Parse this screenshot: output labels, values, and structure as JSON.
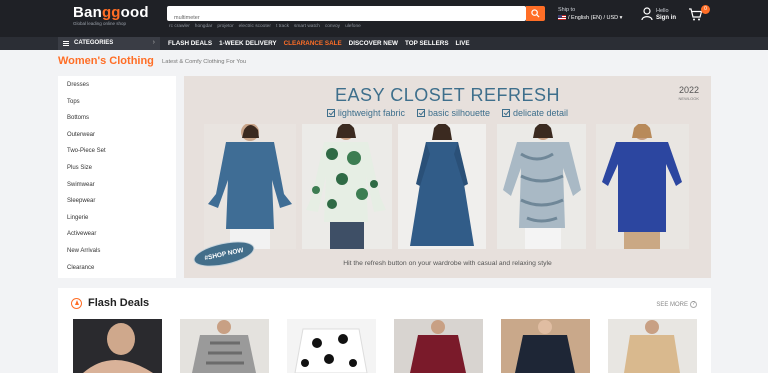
{
  "header": {
    "logo_text": "Banggood",
    "logo_tagline": "Global leading online shop",
    "search": {
      "value": "multimeter",
      "placeholder": ""
    },
    "hot_terms": [
      "rc crawler",
      "hongdar",
      "projetor",
      "electric scooter",
      "t track",
      "smart watch",
      "convoy",
      "ulefone"
    ],
    "ship_to_label": "Ship to",
    "ship_to_value": "/ English (EN) / USD",
    "hello_label": "Hello",
    "signin_label": "Sign in",
    "cart_count": "0"
  },
  "nav": {
    "categories_label": "CATEGORIES",
    "links": [
      "FLASH DEALS",
      "1-WEEK DELIVERY",
      "CLEARANCE SALE",
      "DISCOVER NEW",
      "TOP SELLERS",
      "LIVE"
    ]
  },
  "page": {
    "title": "Women's Clothing",
    "subtitle": "Latest & Comfy Clothing For You"
  },
  "sidebar": {
    "items": [
      "Dresses",
      "Tops",
      "Bottoms",
      "Outerwear",
      "Two-Piece Set",
      "Plus Size",
      "Swimwear",
      "Sleepwear",
      "Lingerie",
      "Activewear",
      "New Arrivals",
      "Clearance"
    ]
  },
  "banner": {
    "title": "EASY CLOSET REFRESH",
    "year": "2022",
    "year_sub": "NEWLOOK",
    "features": [
      "lightweight fabric",
      "basic silhouette",
      "delicate detail"
    ],
    "shop_now": "#SHOP NOW",
    "footer": "Hit the refresh button on your wardrobe with casual and relaxing style"
  },
  "flash_deals": {
    "title": "Flash Deals",
    "see_more": "SEE MORE"
  },
  "colors": {
    "accent": "#ff6e26",
    "header_bg": "#1f2126",
    "banner_text": "#3e6f8c"
  }
}
